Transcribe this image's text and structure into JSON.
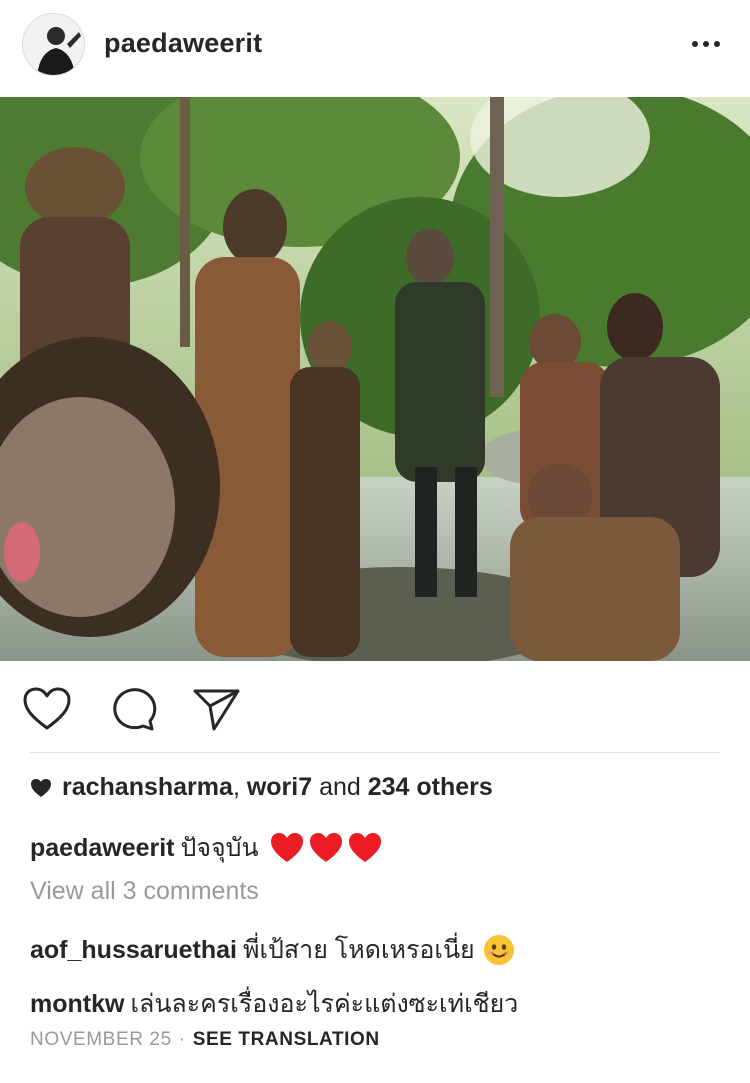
{
  "post": {
    "username": "paedaweerit",
    "avatar_alt": "avatar",
    "menu_icon": "more-horizontal-icon",
    "photo_icon": "post-photo"
  },
  "actions": {
    "like_icon": "heart-outline-icon",
    "comment_icon": "comment-bubble-icon",
    "share_icon": "send-paper-plane-icon"
  },
  "likes": {
    "user1": "rachansharma",
    "sep": ", ",
    "user2": "wori7",
    "and": " and ",
    "others": "234 others"
  },
  "caption": {
    "username": "paedaweerit",
    "text": "ปัจจุบัน",
    "emoji": "red-heart-emoji x3"
  },
  "view_all": "View all 3 comments",
  "comments": [
    {
      "username": "aof_hussaruethai",
      "text": "พี่เป้สาย โหดเหรอเนี่ย",
      "emoji": "smiling-face-emoji"
    },
    {
      "username": "montkw",
      "text": "เล่นละครเรื่องอะไรค่ะแต่งซะเท่เชียว"
    }
  ],
  "footer": {
    "date": "NOVEMBER 25",
    "separator": "·",
    "translate": "SEE TRANSLATION"
  },
  "colors": {
    "text": "#262626",
    "muted": "#999999",
    "heart_red": "#ed1c24"
  }
}
